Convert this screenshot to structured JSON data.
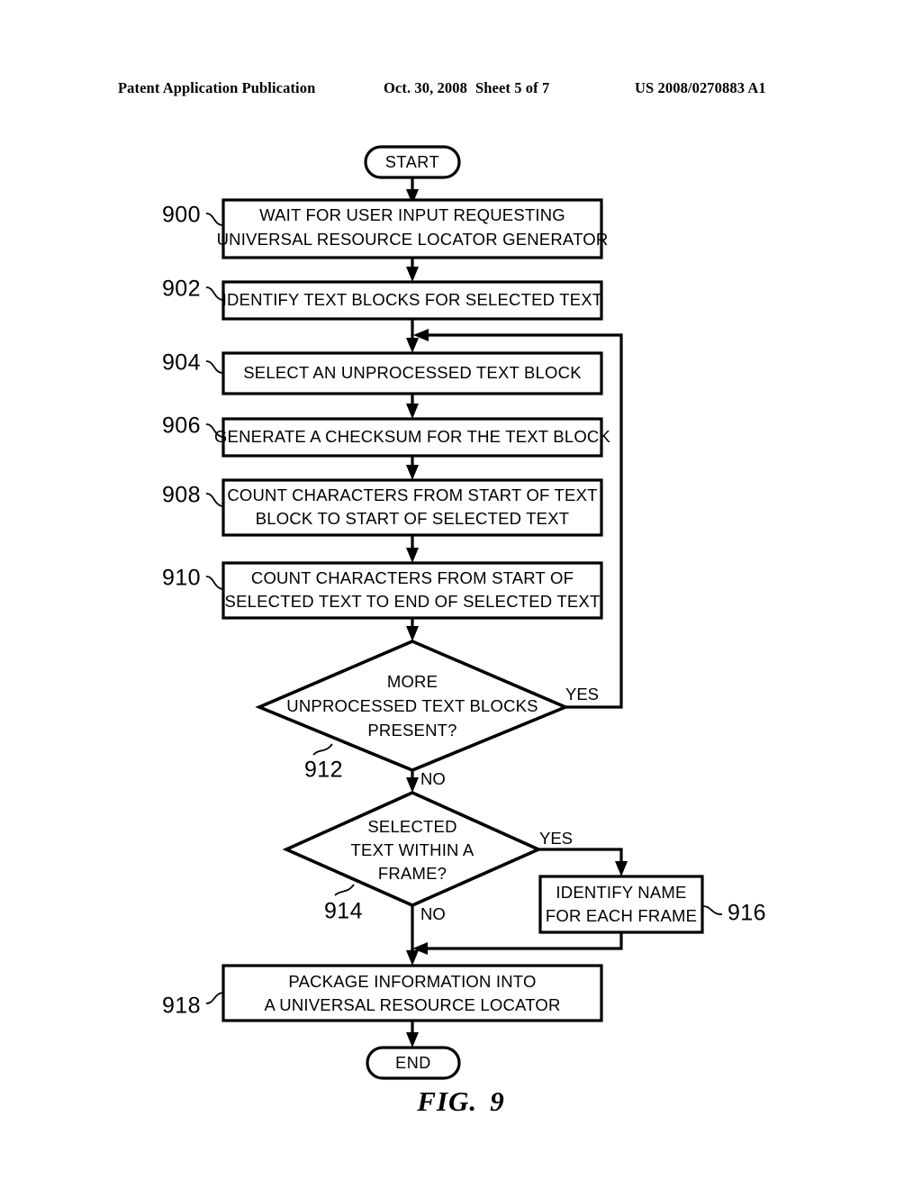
{
  "header": {
    "publication": "Patent Application Publication",
    "date": "Oct. 30, 2008",
    "sheet": "Sheet 5 of 7",
    "patent_number": "US 2008/0270883 A1"
  },
  "figure": {
    "label": "FIG.",
    "number": "9"
  },
  "flowchart": {
    "start_label": "START",
    "end_label": "END",
    "steps": [
      {
        "ref": "900",
        "lines": [
          "WAIT FOR USER INPUT REQUESTING",
          "UNIVERSAL RESOURCE LOCATOR GENERATOR"
        ],
        "shape": "process"
      },
      {
        "ref": "902",
        "lines": [
          "IDENTIFY TEXT BLOCKS FOR SELECTED TEXT"
        ],
        "shape": "process"
      },
      {
        "ref": "904",
        "lines": [
          "SELECT AN UNPROCESSED TEXT BLOCK"
        ],
        "shape": "process"
      },
      {
        "ref": "906",
        "lines": [
          "GENERATE A CHECKSUM FOR THE TEXT BLOCK"
        ],
        "shape": "process"
      },
      {
        "ref": "908",
        "lines": [
          "COUNT CHARACTERS FROM START OF TEXT",
          "BLOCK TO START OF SELECTED TEXT"
        ],
        "shape": "process"
      },
      {
        "ref": "910",
        "lines": [
          "COUNT CHARACTERS FROM START OF",
          "SELECTED TEXT TO END OF SELECTED TEXT"
        ],
        "shape": "process"
      },
      {
        "ref": "912",
        "lines": [
          "MORE",
          "UNPROCESSED TEXT BLOCKS",
          "PRESENT?"
        ],
        "shape": "decision",
        "yes_label": "YES",
        "no_label": "NO"
      },
      {
        "ref": "914",
        "lines": [
          "SELECTED",
          "TEXT WITHIN A",
          "FRAME?"
        ],
        "shape": "decision",
        "yes_label": "YES",
        "no_label": "NO"
      },
      {
        "ref": "916",
        "lines": [
          "IDENTIFY NAME",
          "FOR EACH FRAME"
        ],
        "shape": "process"
      },
      {
        "ref": "918",
        "lines": [
          "PACKAGE INFORMATION INTO",
          "A UNIVERSAL RESOURCE LOCATOR"
        ],
        "shape": "process"
      }
    ],
    "colors": {
      "stroke": "#000000",
      "fill": "#ffffff"
    }
  }
}
